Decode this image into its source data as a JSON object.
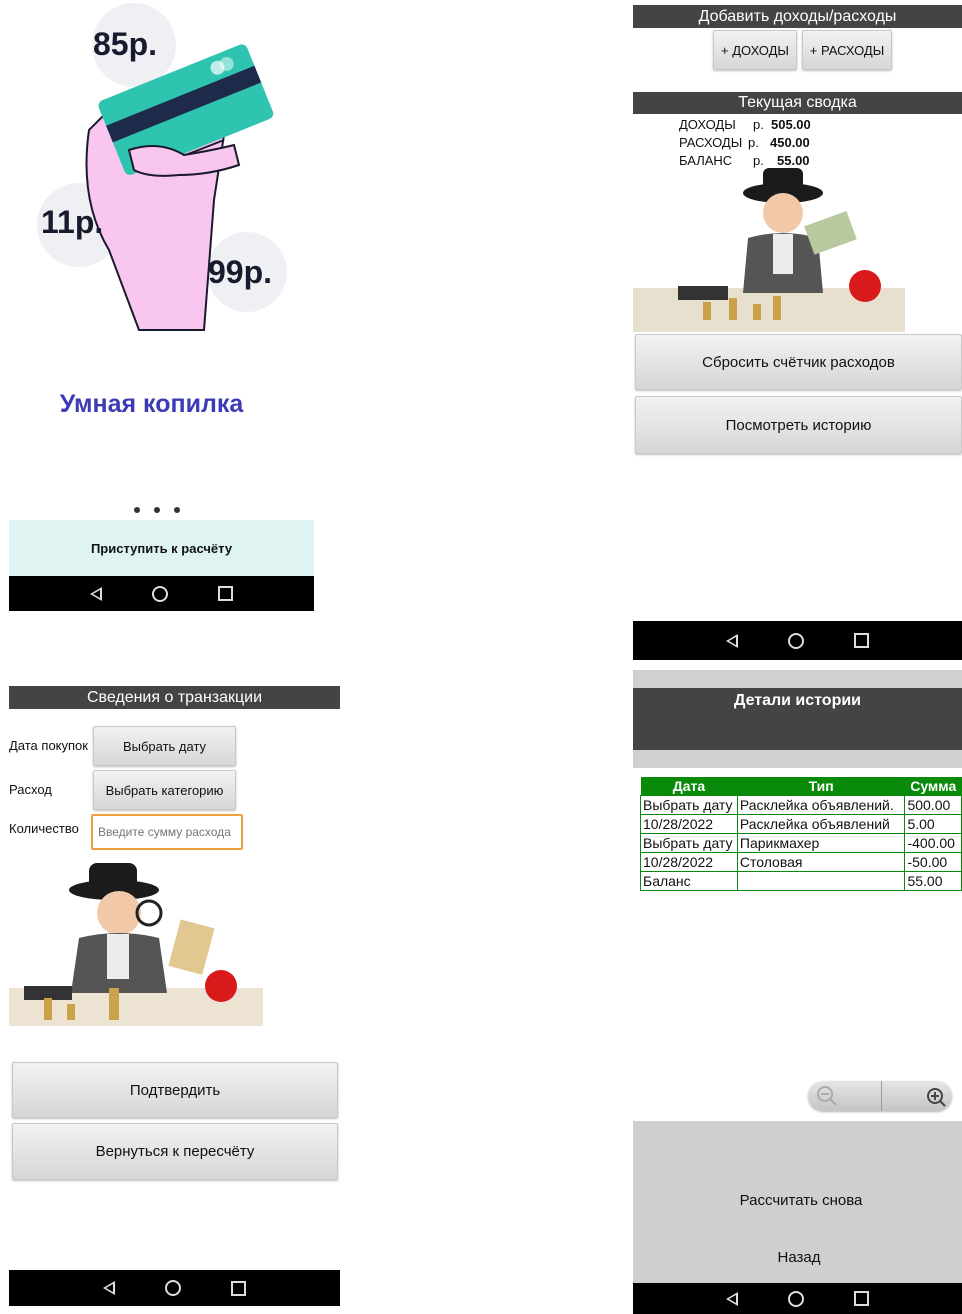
{
  "splash": {
    "prices": [
      "85р.",
      "11р.",
      "99р."
    ],
    "title": "Умная копилка",
    "start_button": "Приступить к расчёту"
  },
  "main": {
    "add_header": "Добавить доходы/расходы",
    "income_button": "+ ДОХОДЫ",
    "expense_button": "+ РАСХОДЫ",
    "summary_header": "Текущая сводка",
    "summary_rows": [
      {
        "label": "ДОХОДЫ",
        "currency": "р.",
        "value": "505.00"
      },
      {
        "label": "РАСХОДЫ",
        "currency": "р.",
        "value": "450.00"
      },
      {
        "label": "БАЛАНС",
        "currency": "р.",
        "value": "55.00"
      }
    ],
    "reset_button": "Сбросить счётчик расходов",
    "history_button": "Посмотреть историю"
  },
  "transaction": {
    "header": "Сведения о транзакции",
    "date_label": "Дата покупок",
    "date_button": "Выбрать дату",
    "expense_label": "Расход",
    "category_button": "Выбрать категорию",
    "amount_label": "Количество",
    "amount_placeholder": "Введите сумму расхода",
    "confirm_button": "Подтвердить",
    "back_button": "Вернуться к пересчёту"
  },
  "history": {
    "header": "Детали истории",
    "columns": [
      "Дата",
      "Тип",
      "Сумма"
    ],
    "rows": [
      [
        "Выбрать дату",
        "Расклейка объявлений.",
        "500.00"
      ],
      [
        "10/28/2022",
        "Расклейка объявлений",
        "5.00"
      ],
      [
        "Выбрать дату",
        "Парикмахер",
        "-400.00"
      ],
      [
        "10/28/2022",
        "Столовая",
        "-50.00"
      ],
      [
        "Баланс",
        "",
        "55.00"
      ]
    ],
    "recalc_button": "Рассчитать снова",
    "back_button": "Назад"
  },
  "colors": {
    "title_bar": "#444444",
    "table_header": "#0a8a0a",
    "splash_title": "#3b3bb5",
    "card": "#2ec4b0",
    "hand": "#f8c6ee",
    "input_focus": "#e8a33a"
  },
  "icons": [
    "back-icon",
    "home-icon",
    "recent-apps-icon",
    "zoom-out-icon",
    "zoom-in-icon"
  ]
}
